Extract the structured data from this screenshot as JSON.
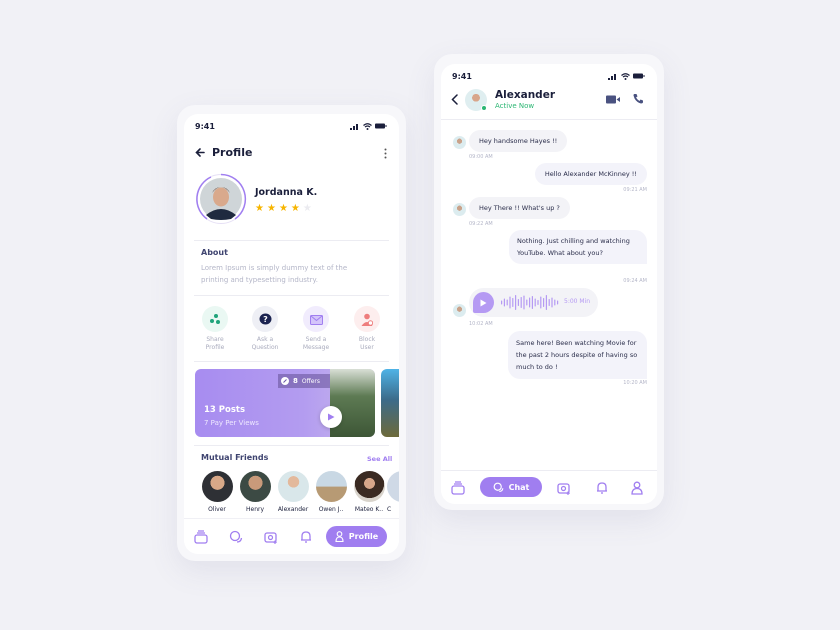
{
  "profile_screen": {
    "status_time": "9:41",
    "header_title": "Profile",
    "user_name": "Jordanna K.",
    "rating": 4,
    "rating_max": 5,
    "about_title": "About",
    "about_text_line1": "Lorem Ipsum is simply dummy text of the",
    "about_text_line2": "printing and typesetting industry.",
    "actions": [
      {
        "line1": "Share",
        "line2": "Profile",
        "icon": "share-icon",
        "bg": "#eaf8f3",
        "color": "#1fa37a"
      },
      {
        "line1": "Ask a",
        "line2": "Question",
        "icon": "question-icon",
        "bg": "#eeeff5",
        "color": "#1b2350"
      },
      {
        "line1": "Send a",
        "line2": "Message",
        "icon": "mail-icon",
        "bg": "#f1ecfd",
        "color": "#a07ef0"
      },
      {
        "line1": "Block",
        "line2": "User",
        "icon": "block-user-icon",
        "bg": "#fdeeee",
        "color": "#ee7d7d"
      }
    ],
    "card": {
      "posts": "13 Posts",
      "ppv": "7 Pay Per Views",
      "offers_count": "8",
      "offers_label": "Offers"
    },
    "mutual_title": "Mutual Friends",
    "see_all": "See All",
    "friends": [
      {
        "name": "Oliver",
        "color": "#2e3035"
      },
      {
        "name": "Henry",
        "color": "#3c4a44"
      },
      {
        "name": "Alexander",
        "color": "#d9e7ea"
      },
      {
        "name": "Owen J..",
        "color": "#b79a74"
      },
      {
        "name": "Mateo K..",
        "color": "#5a4638"
      },
      {
        "name": "C",
        "color": "#cfd9e6"
      }
    ],
    "nav_active_label": "Profile"
  },
  "chat_screen": {
    "status_time": "9:41",
    "contact_name": "Alexander",
    "contact_status": "Active Now",
    "messages": [
      {
        "text": "Hey handsome Hayes !!",
        "time": "09:00 AM",
        "dir": "in"
      },
      {
        "text": "Hello Alexander McKinney !!",
        "time": "09:21 AM",
        "dir": "out"
      },
      {
        "text": "Hey There !! What's up ?",
        "time": "09:22 AM",
        "dir": "in"
      },
      {
        "text": "Nothing. Just chilling and watching YouTube. What about you?",
        "time": "09:24 AM",
        "dir": "out"
      },
      {
        "text": "",
        "duration": "5:00 Min",
        "time": "10:02 AM",
        "dir": "in",
        "type": "voice"
      },
      {
        "text": "Same here! Been watching Movie for the past 2 hours despite of having so much to do !",
        "time": "10:20 AM",
        "dir": "out"
      }
    ],
    "nav_active_label": "Chat"
  },
  "colors": {
    "accent": "#a07ef0",
    "star": "#f7b500",
    "star_empty": "#ebebf0",
    "online": "#2bb673",
    "text_dark": "#1b1f3b"
  }
}
